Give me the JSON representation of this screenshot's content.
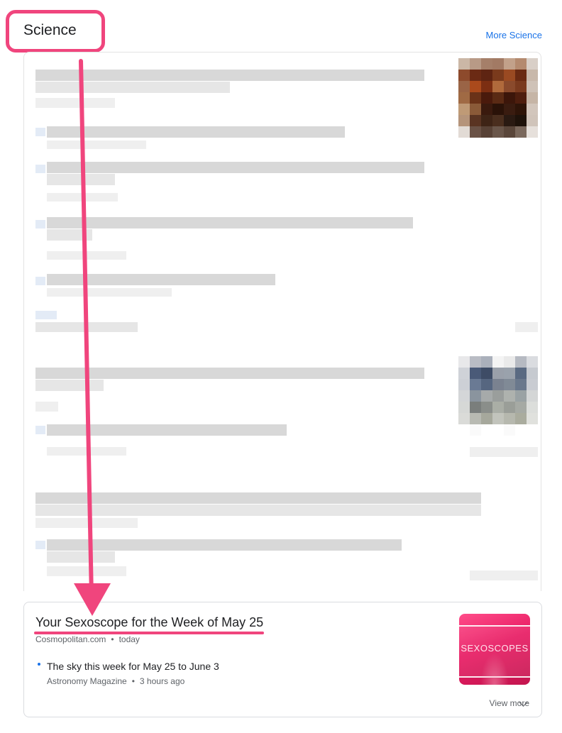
{
  "header": {
    "title": "Science",
    "more_link": "More Science"
  },
  "annotation": {
    "color": "#f0457d"
  },
  "feature": {
    "headline": "Your Sexoscope for the Week of May 25",
    "source": "Cosmopolitan.com",
    "time": "today",
    "related": {
      "title": "The sky this week for May 25 to June 3",
      "source": "Astronomy Magazine",
      "time": "3 hours ago"
    },
    "thumbnail_text": "SEXOSCOPES",
    "view_more": "View more"
  },
  "colors": {
    "link": "#1a73e8",
    "text": "#202124",
    "meta": "#5f6368"
  }
}
